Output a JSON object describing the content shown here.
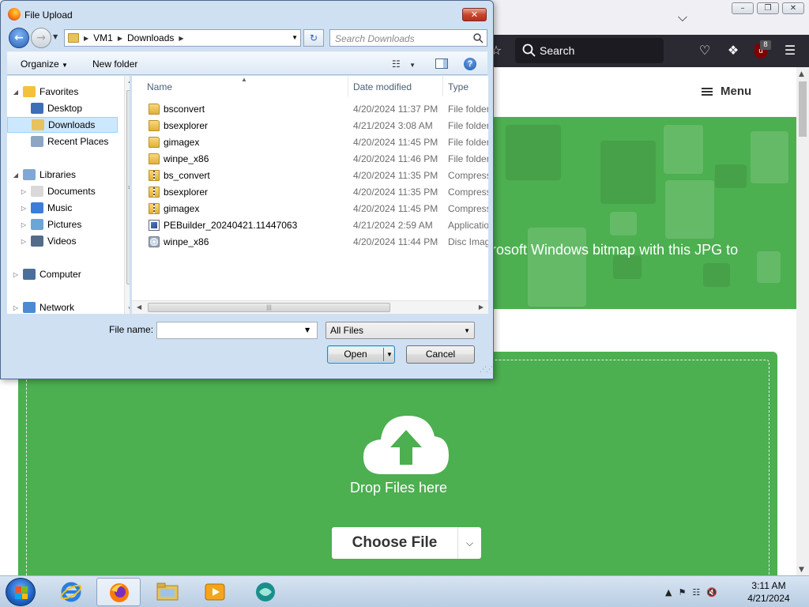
{
  "browser": {
    "toolbar_search_placeholder": "Search",
    "extension_badge": "8",
    "menu_label": "Menu",
    "hero_text": "rosoft Windows bitmap with this JPG to",
    "drop_text": "Drop Files here",
    "choose_file_label": "Choose File",
    "accent_color": "#4caf50"
  },
  "dialog": {
    "title": "File Upload",
    "breadcrumb": [
      "VM1",
      "Downloads"
    ],
    "search_placeholder": "Search Downloads",
    "organize_label": "Organize",
    "new_folder_label": "New folder",
    "nav": [
      {
        "label": "Favorites",
        "icon": "star-icon",
        "level": 0,
        "expander": "open"
      },
      {
        "label": "Desktop",
        "icon": "desktop-icon",
        "level": 1
      },
      {
        "label": "Downloads",
        "icon": "downloads-folder-icon",
        "level": 1,
        "selected": true
      },
      {
        "label": "Recent Places",
        "icon": "recent-places-icon",
        "level": 1
      },
      {
        "label": "Libraries",
        "icon": "libraries-icon",
        "level": 0,
        "expander": "open"
      },
      {
        "label": "Documents",
        "icon": "documents-icon",
        "level": 1,
        "expander": "closed"
      },
      {
        "label": "Music",
        "icon": "music-icon",
        "level": 1,
        "expander": "closed"
      },
      {
        "label": "Pictures",
        "icon": "pictures-icon",
        "level": 1,
        "expander": "closed"
      },
      {
        "label": "Videos",
        "icon": "videos-icon",
        "level": 1,
        "expander": "closed"
      },
      {
        "label": "Computer",
        "icon": "computer-icon",
        "level": 0,
        "expander": "closed"
      },
      {
        "label": "Network",
        "icon": "network-icon",
        "level": 0,
        "expander": "closed"
      }
    ],
    "columns": {
      "name": "Name",
      "date": "Date modified",
      "type": "Type"
    },
    "files": [
      {
        "name": "bsconvert",
        "date": "4/20/2024 11:37 PM",
        "type": "File folder",
        "icon": "folder"
      },
      {
        "name": "bsexplorer",
        "date": "4/21/2024 3:08 AM",
        "type": "File folder",
        "icon": "folder"
      },
      {
        "name": "gimagex",
        "date": "4/20/2024 11:45 PM",
        "type": "File folder",
        "icon": "folder"
      },
      {
        "name": "winpe_x86",
        "date": "4/20/2024 11:46 PM",
        "type": "File folder",
        "icon": "folder"
      },
      {
        "name": "bs_convert",
        "date": "4/20/2024 11:35 PM",
        "type": "Compress",
        "icon": "zip"
      },
      {
        "name": "bsexplorer",
        "date": "4/20/2024 11:35 PM",
        "type": "Compress",
        "icon": "zip"
      },
      {
        "name": "gimagex",
        "date": "4/20/2024 11:45 PM",
        "type": "Compress",
        "icon": "zip"
      },
      {
        "name": "PEBuilder_20240421.11447063",
        "date": "4/21/2024 2:59 AM",
        "type": "Applicatio",
        "icon": "exe"
      },
      {
        "name": "winpe_x86",
        "date": "4/20/2024 11:44 PM",
        "type": "Disc Imag",
        "icon": "iso"
      }
    ],
    "file_name_label": "File name:",
    "file_name_value": "",
    "file_type_value": "All Files",
    "open_label": "Open",
    "cancel_label": "Cancel"
  },
  "taskbar": {
    "time": "3:11 AM",
    "date": "4/21/2024"
  }
}
